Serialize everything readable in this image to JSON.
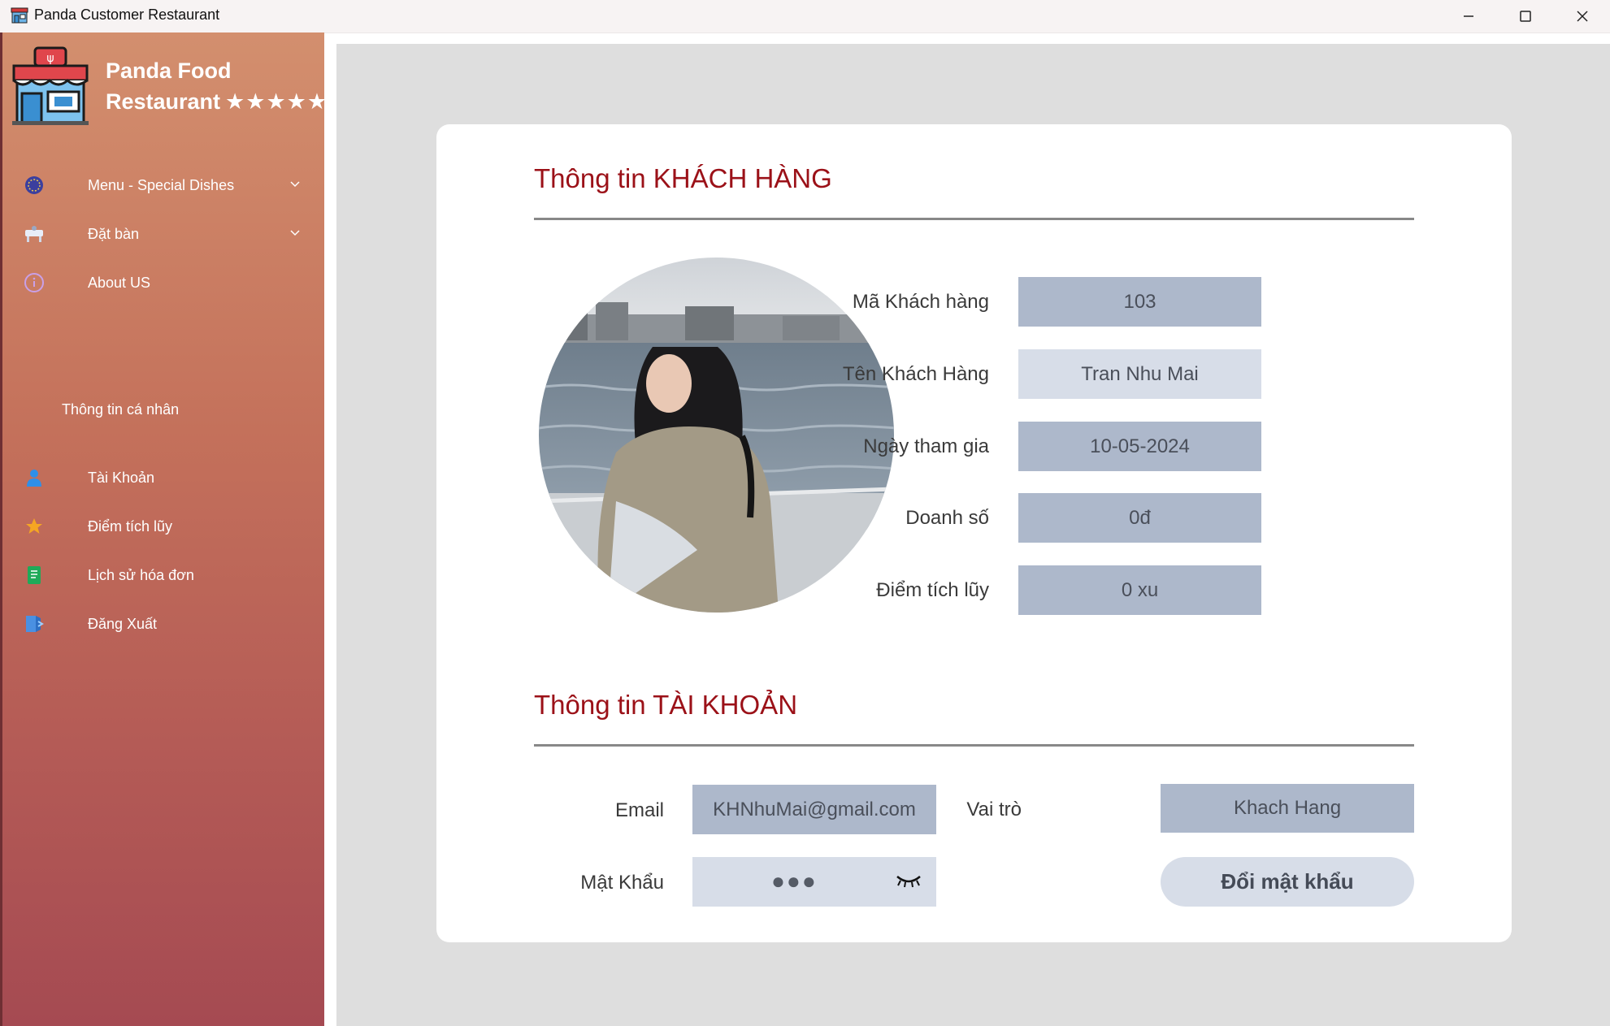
{
  "window": {
    "title": "Panda Customer Restaurant"
  },
  "sidebar": {
    "brand_line1": "Panda Food",
    "brand_line2": "Restaurant",
    "brand_stars": "★★★★★",
    "items_top": [
      {
        "label": "Menu - Special Dishes",
        "icon": "globe-icon",
        "has_chevron": true
      },
      {
        "label": "Đặt bàn",
        "icon": "table-icon",
        "has_chevron": true
      },
      {
        "label": "About US",
        "icon": "info-icon",
        "has_chevron": false
      }
    ],
    "section_label": "Thông tin cá nhân",
    "items_bottom": [
      {
        "label": "Tài Khoản",
        "icon": "user-icon"
      },
      {
        "label": "Điểm tích lũy",
        "icon": "star-icon"
      },
      {
        "label": "Lịch sử hóa đơn",
        "icon": "receipt-icon"
      },
      {
        "label": "Đăng Xuất",
        "icon": "logout-icon"
      }
    ]
  },
  "customer": {
    "section_title": "Thông tin KHÁCH HÀNG",
    "fields": [
      {
        "label": "Mã Khách hàng",
        "value": "103"
      },
      {
        "label": "Tên Khách Hàng",
        "value": "Tran Nhu Mai"
      },
      {
        "label": "Ngày tham gia",
        "value": "10-05-2024"
      },
      {
        "label": "Doanh số",
        "value": "0đ"
      },
      {
        "label": "Điểm tích lũy",
        "value": "0 xu"
      }
    ]
  },
  "account": {
    "section_title": "Thông tin TÀI KHOẢN",
    "email_label": "Email",
    "email_value": "KHNhuMai@gmail.com",
    "role_label": "Vai trò",
    "role_value": "Khach Hang",
    "password_label": "Mật Khẩu",
    "password_mask": "●●●",
    "change_password_label": "Đổi mật khẩu"
  },
  "colors": {
    "accent_title": "#9b1118",
    "field_dark": "#adb8cb",
    "field_light": "#d7dde8",
    "main_bg": "#dedede"
  }
}
